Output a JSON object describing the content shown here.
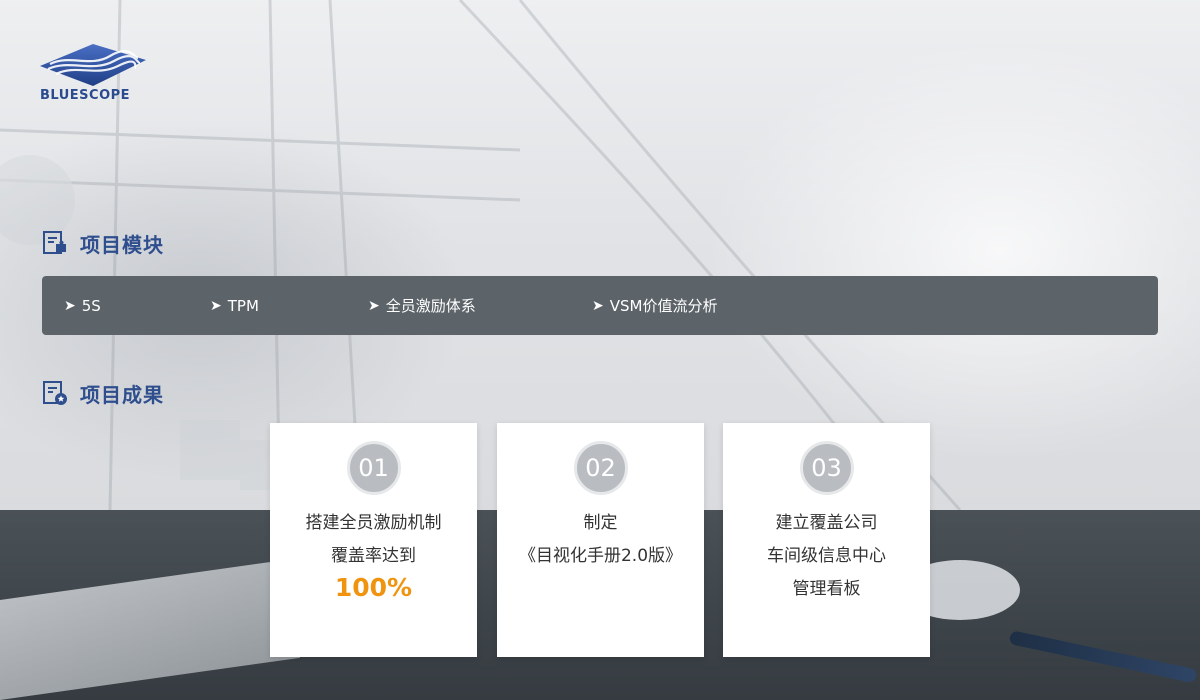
{
  "brand": {
    "logo_text": "BLUESCOPE",
    "primary_color": "#2f4e8e"
  },
  "sections": {
    "modules": {
      "title": "项目模块",
      "icon": "puzzle-document-icon",
      "items": [
        {
          "label": "5S"
        },
        {
          "label": "TPM"
        },
        {
          "label": "全员激励体系"
        },
        {
          "label": "VSM价值流分析"
        }
      ]
    },
    "results": {
      "title": "项目成果",
      "icon": "star-document-icon",
      "cards": [
        {
          "number": "01",
          "lines": [
            "搭建全员激励机制",
            "覆盖率达到"
          ],
          "highlight": "100%"
        },
        {
          "number": "02",
          "lines": [
            "制定",
            "《目视化手册2.0版》"
          ],
          "highlight": ""
        },
        {
          "number": "03",
          "lines": [
            "建立覆盖公司",
            "车间级信息中心",
            "管理看板"
          ],
          "highlight": ""
        }
      ]
    }
  },
  "colors": {
    "bar_bg": "#5c6369",
    "highlight": "#f0930f",
    "number_circle": "#b9bdc2"
  }
}
